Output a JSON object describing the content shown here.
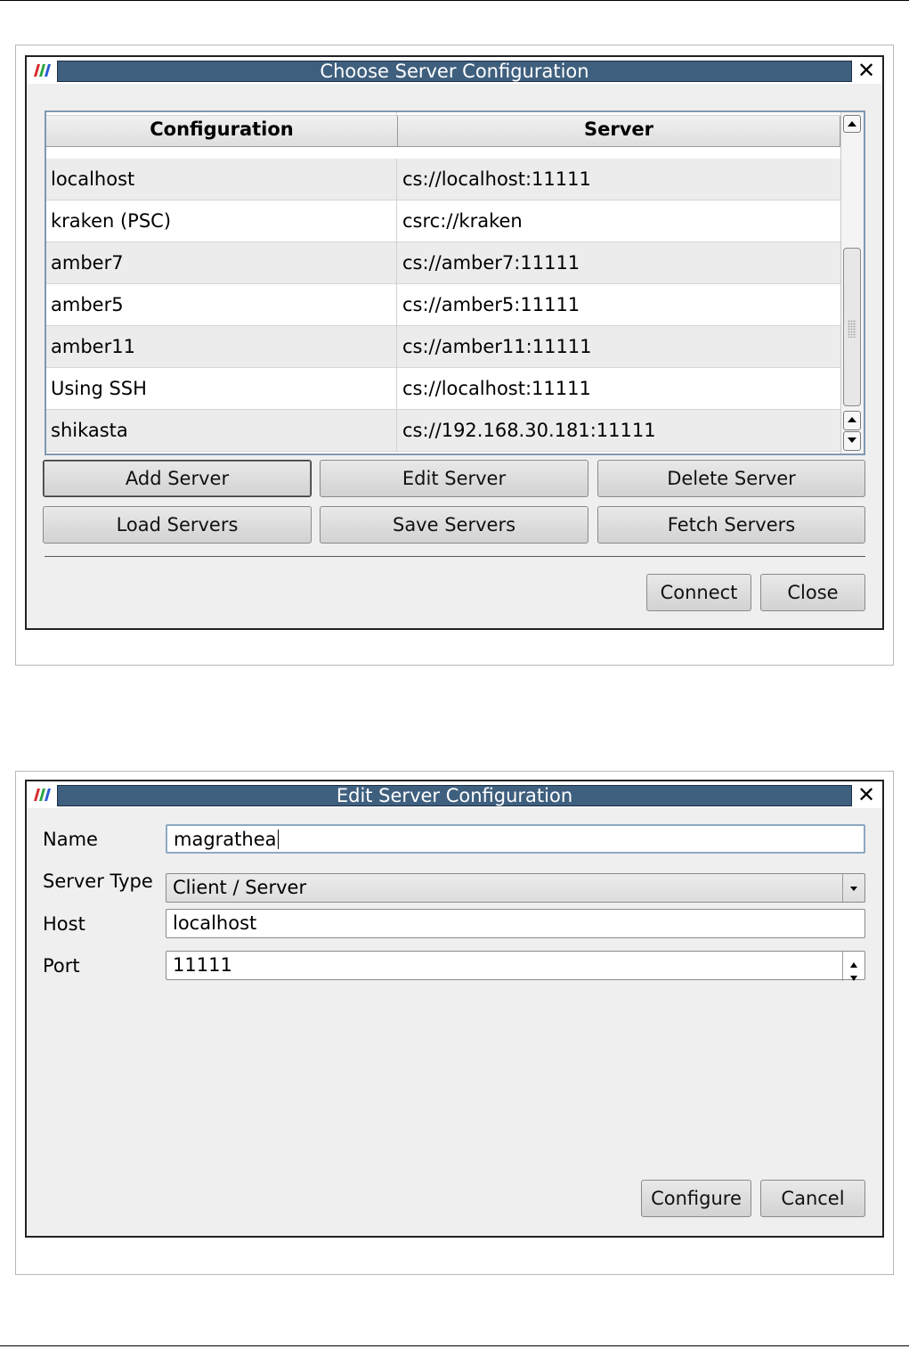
{
  "choose_dialog": {
    "title": "Choose Server Configuration",
    "columns": [
      "Configuration",
      "Server"
    ],
    "rows": [
      {
        "config": "localhost",
        "server": "cs://localhost:11111"
      },
      {
        "config": "kraken (PSC)",
        "server": "csrc://kraken"
      },
      {
        "config": "amber7",
        "server": "cs://amber7:11111"
      },
      {
        "config": "amber5",
        "server": "cs://amber5:11111"
      },
      {
        "config": "amber11",
        "server": "cs://amber11:11111"
      },
      {
        "config": "Using SSH",
        "server": "cs://localhost:11111"
      },
      {
        "config": "shikasta",
        "server": "cs://192.168.30.181:11111"
      }
    ],
    "buttons": {
      "add": "Add Server",
      "edit": "Edit Server",
      "delete": "Delete Server",
      "load": "Load Servers",
      "save": "Save Servers",
      "fetch": "Fetch Servers",
      "connect": "Connect",
      "close": "Close"
    }
  },
  "edit_dialog": {
    "title": "Edit Server Configuration",
    "labels": {
      "name": "Name",
      "server_type": "Server Type",
      "host": "Host",
      "port": "Port"
    },
    "values": {
      "name": "magrathea",
      "server_type": "Client / Server",
      "host": "localhost",
      "port": "11111"
    },
    "buttons": {
      "configure": "Configure",
      "cancel": "Cancel"
    }
  },
  "icons": [
    "app-logo-icon",
    "close-icon",
    "scroll-up-icon",
    "scroll-down-icon",
    "dropdown-arrow-icon",
    "spin-up-icon",
    "spin-down-icon"
  ],
  "colors": {
    "title_bar": "#3f5f7e",
    "table_border": "#7f98b0",
    "alt_row": "#ececec",
    "dialog_bg": "#efefef"
  }
}
